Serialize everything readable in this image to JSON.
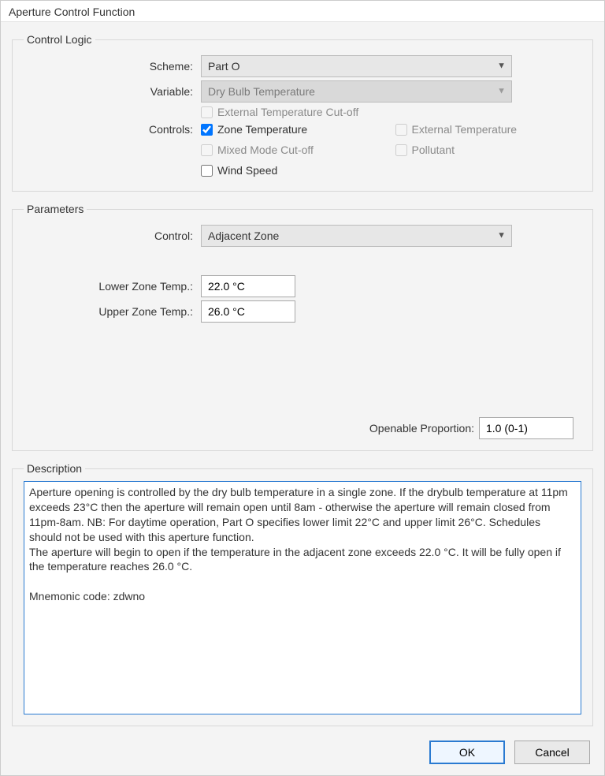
{
  "window": {
    "title": "Aperture Control Function"
  },
  "controlLogic": {
    "legend": "Control Logic",
    "schemeLabel": "Scheme:",
    "schemeValue": "Part O",
    "variableLabel": "Variable:",
    "variableValue": "Dry Bulb Temperature",
    "controlsLabel": "Controls:",
    "checks": {
      "extTempCutoff": {
        "label": "External Temperature Cut-off",
        "checked": false,
        "enabled": false
      },
      "zoneTemp": {
        "label": "Zone Temperature",
        "checked": true,
        "enabled": true
      },
      "extTemp": {
        "label": "External Temperature",
        "checked": false,
        "enabled": false
      },
      "mixedMode": {
        "label": "Mixed Mode Cut-off",
        "checked": false,
        "enabled": false
      },
      "pollutant": {
        "label": "Pollutant",
        "checked": false,
        "enabled": false
      },
      "windSpeed": {
        "label": "Wind Speed",
        "checked": false,
        "enabled": true
      }
    }
  },
  "parameters": {
    "legend": "Parameters",
    "controlLabel": "Control:",
    "controlValue": "Adjacent Zone",
    "lowerLabel": "Lower Zone Temp.:",
    "lowerValue": "22.0 °C",
    "upperLabel": "Upper Zone Temp.:",
    "upperValue": "26.0 °C",
    "openablePropLabel": "Openable Proportion:",
    "openablePropValue": "1.0 (0-1)"
  },
  "description": {
    "legend": "Description",
    "text": "Aperture opening is controlled by the dry bulb temperature in a single zone. If the drybulb temperature at 11pm exceeds 23°C then the aperture will remain open until 8am - otherwise the aperture will remain closed from 11pm-8am. NB: For daytime operation, Part O specifies lower limit 22°C and upper limit 26°C. Schedules should not be used with this aperture function.\nThe aperture will begin to open if the temperature in the adjacent zone exceeds 22.0 °C. It will be fully open if the temperature reaches 26.0 °C.\n\nMnemonic code: zdwno"
  },
  "buttons": {
    "ok": "OK",
    "cancel": "Cancel"
  }
}
